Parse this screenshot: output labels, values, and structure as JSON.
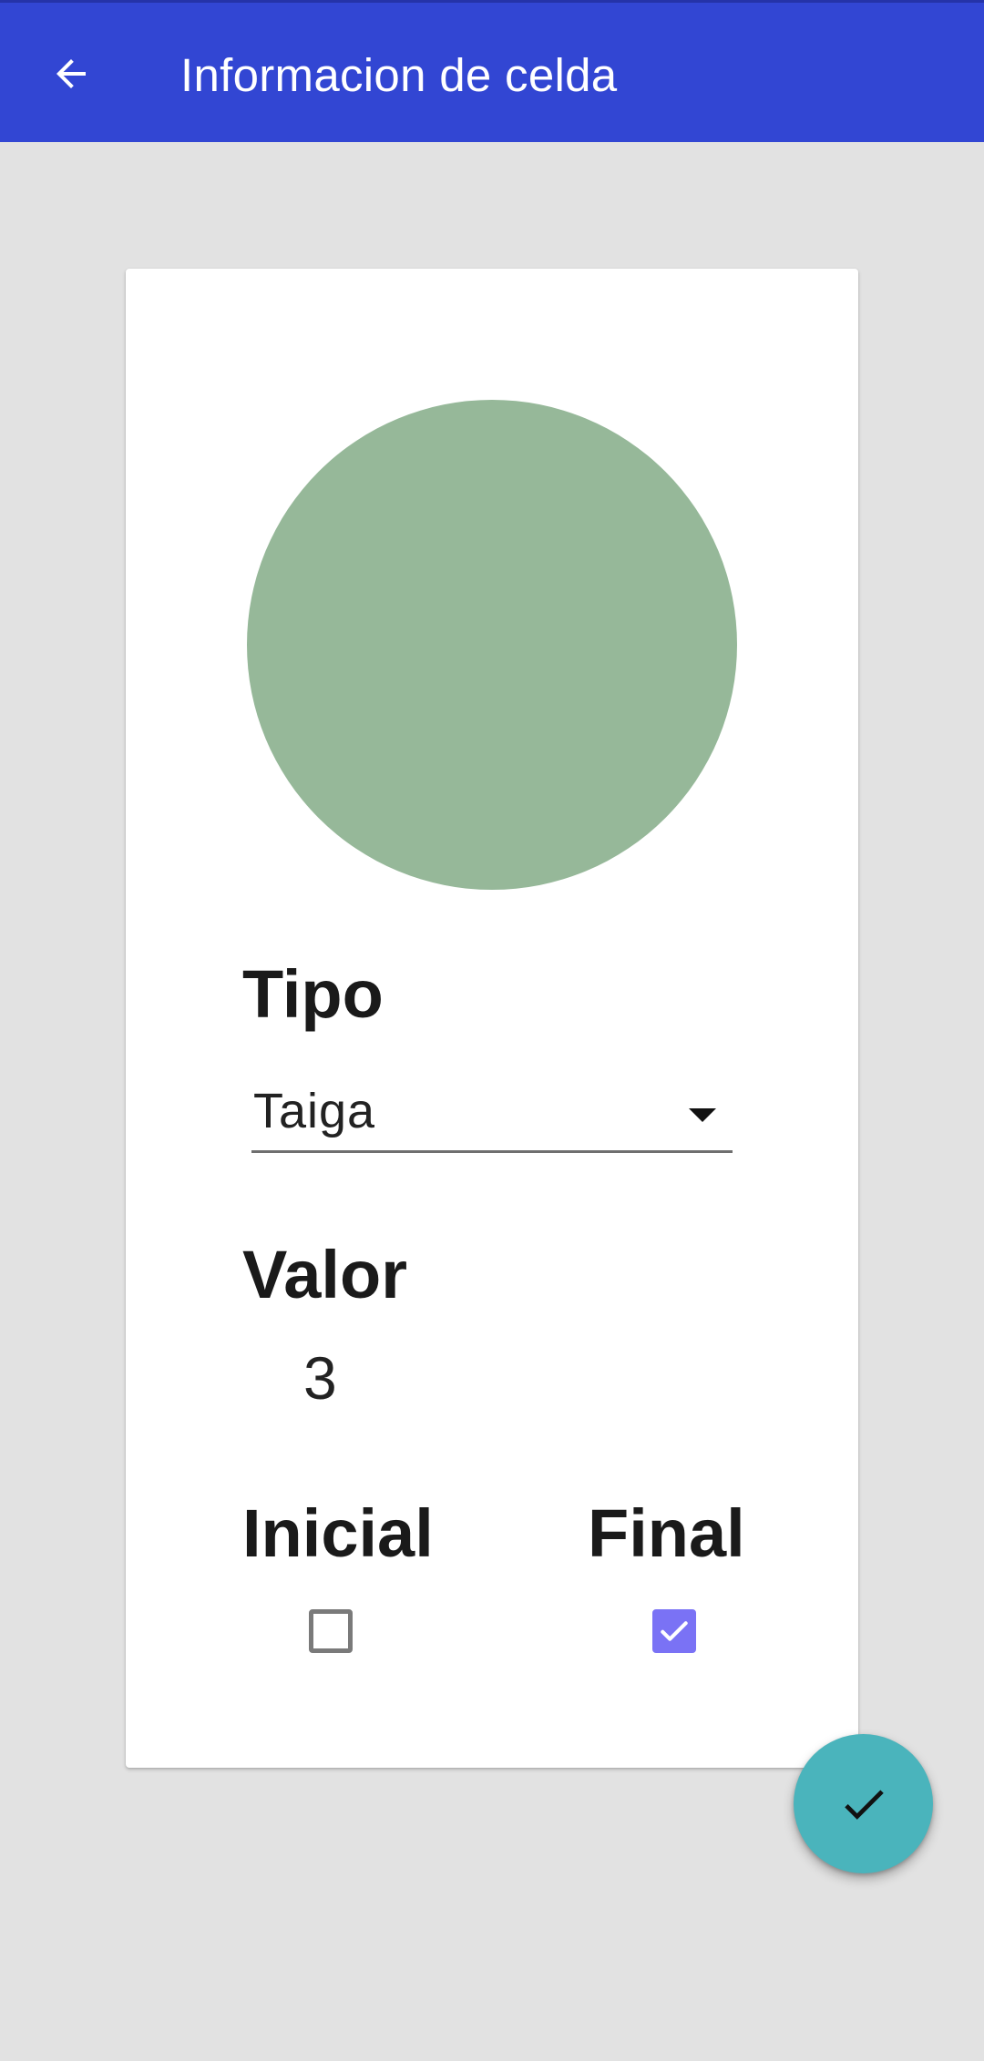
{
  "appbar": {
    "title": "Informacion de celda",
    "back_icon": "arrow-back-icon",
    "color": "#3246d3"
  },
  "cell": {
    "color": "#96b899"
  },
  "tipo": {
    "label": "Tipo",
    "selected": "Taiga"
  },
  "valor": {
    "label": "Valor",
    "value": "3"
  },
  "inicial": {
    "label": "Inicial",
    "checked": false
  },
  "final": {
    "label": "Final",
    "checked": true,
    "accent": "#7a72f5"
  },
  "fab": {
    "icon": "check-icon",
    "color": "#4ab4bc"
  }
}
